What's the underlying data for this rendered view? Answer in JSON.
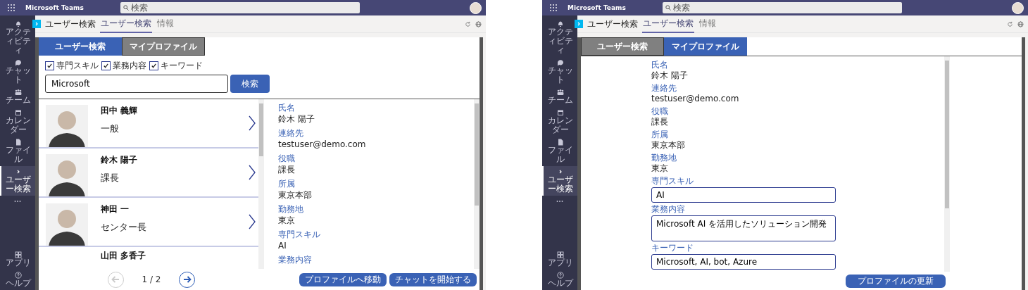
{
  "screens": [
    {
      "app_name": "Microsoft Teams",
      "search": {
        "placeholder": "検索"
      },
      "rail": [
        {
          "label": "アクティビティ",
          "selected": false
        },
        {
          "label": "チャット",
          "selected": false
        },
        {
          "label": "チーム",
          "selected": false
        },
        {
          "label": "カレンダー",
          "selected": false
        },
        {
          "label": "ファイル",
          "selected": false
        },
        {
          "label": "ユーザー検索",
          "selected": true
        }
      ],
      "rail_bottom": [
        {
          "label": "アプリ"
        },
        {
          "label": "ヘルプ"
        }
      ],
      "app_header": {
        "title": "ユーザー検索",
        "tabs": [
          {
            "label": "ユーザー検索",
            "selected": true
          },
          {
            "label": "情報",
            "selected": false
          }
        ]
      },
      "content_tabs": [
        {
          "label": "ユーザー検索",
          "selected": true
        },
        {
          "label": "マイプロファイル",
          "selected": false
        }
      ],
      "view": {
        "kind": "search",
        "filters": [
          {
            "label": "専門スキル",
            "checked": true
          },
          {
            "label": "業務内容",
            "checked": true
          },
          {
            "label": "キーワード",
            "checked": true
          }
        ],
        "query": "Microsoft",
        "search_button": "検索",
        "results": [
          {
            "name": "田中 義輝",
            "title": "一般"
          },
          {
            "name": "鈴木 陽子",
            "title": "課長"
          },
          {
            "name": "神田 一",
            "title": "センター長"
          },
          {
            "name": "山田 多香子"
          }
        ],
        "pager": {
          "label": "1 / 2",
          "prev_disabled": true,
          "next_disabled": false
        },
        "details": [
          {
            "label": "氏名",
            "value": "鈴木 陽子"
          },
          {
            "label": "連絡先",
            "value": "testuser@demo.com"
          },
          {
            "label": "役職",
            "value": "課長"
          },
          {
            "label": "所属",
            "value": "東京本部"
          },
          {
            "label": "勤務地",
            "value": "東京"
          },
          {
            "label": "専門スキル",
            "value": "AI"
          },
          {
            "label": "業務内容"
          }
        ],
        "buttons": [
          "プロファイルへ移動",
          "チャットを開始する"
        ]
      }
    },
    {
      "app_name": "Microsoft Teams",
      "search": {
        "placeholder": "検索"
      },
      "rail": [
        {
          "label": "アクティビティ",
          "selected": false
        },
        {
          "label": "チャット",
          "selected": false
        },
        {
          "label": "チーム",
          "selected": false
        },
        {
          "label": "カレンダー",
          "selected": false
        },
        {
          "label": "ファイル",
          "selected": false
        },
        {
          "label": "ユーザー検索",
          "selected": true
        }
      ],
      "rail_bottom": [
        {
          "label": "アプリ"
        },
        {
          "label": "ヘルプ"
        }
      ],
      "app_header": {
        "title": "ユーザー検索",
        "tabs": [
          {
            "label": "ユーザー検索",
            "selected": true
          },
          {
            "label": "情報",
            "selected": false
          }
        ]
      },
      "content_tabs": [
        {
          "label": "ユーザー検索",
          "selected": false
        },
        {
          "label": "マイプロファイル",
          "selected": true
        }
      ],
      "view": {
        "kind": "profile",
        "fields": [
          {
            "kind": "text",
            "label": "氏名",
            "value": "鈴木 陽子"
          },
          {
            "kind": "text",
            "label": "連絡先",
            "value": "testuser@demo.com"
          },
          {
            "kind": "text",
            "label": "役職",
            "value": "課長"
          },
          {
            "kind": "text",
            "label": "所属",
            "value": "東京本部"
          },
          {
            "kind": "text",
            "label": "勤務地",
            "value": "東京"
          },
          {
            "kind": "input",
            "label": "専門スキル",
            "value": "AI"
          },
          {
            "kind": "textarea",
            "label": "業務内容",
            "value": "Microsoft AI を活用したソリューション開発"
          },
          {
            "kind": "input",
            "label": "キーワード",
            "value": "Microsoft, AI, bot, Azure"
          }
        ],
        "update_button": "プロファイルの更新"
      }
    }
  ]
}
